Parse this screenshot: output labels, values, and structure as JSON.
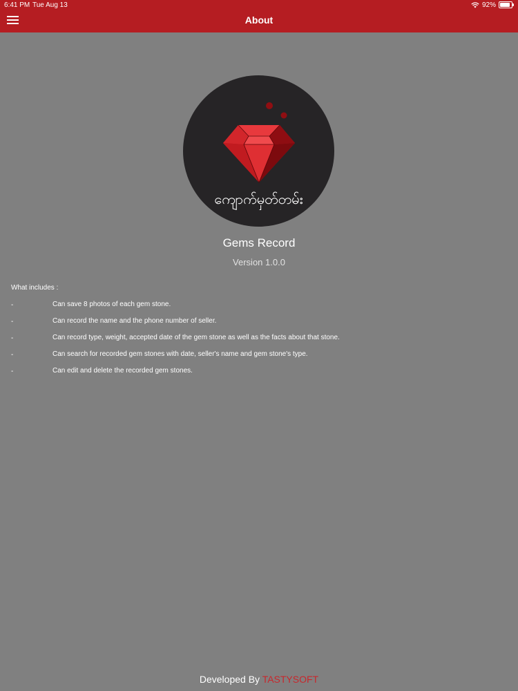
{
  "status_bar": {
    "time": "6:41 PM",
    "date": "Tue Aug 13",
    "battery": "92%"
  },
  "nav": {
    "title": "About"
  },
  "about": {
    "logo_text": "ကျောက်မှတ်တမ်း",
    "app_name": "Gems Record",
    "version": "Version 1.0.0",
    "includes_heading": "What includes :",
    "bullet": "-",
    "features": [
      "Can save 8 photos of each gem stone.",
      "Can record the name and the phone number of seller.",
      "Can record type, weight, accepted date of the gem stone as well as the facts about that stone.",
      "Can search for recorded gem stones with date, seller's name and gem stone's type.",
      "Can edit and delete the recorded gem stones."
    ]
  },
  "footer": {
    "prefix": "Developed By ",
    "brand": "TASTYSOFT"
  },
  "colors": {
    "nav_bar": "#b51d22",
    "background": "#808080",
    "brand_red": "#c8262b",
    "logo_circle": "#262426"
  },
  "icons": {
    "menu": "hamburger-menu-icon",
    "wifi": "wifi-icon",
    "battery": "battery-icon",
    "logo": "ruby-gem-icon"
  }
}
